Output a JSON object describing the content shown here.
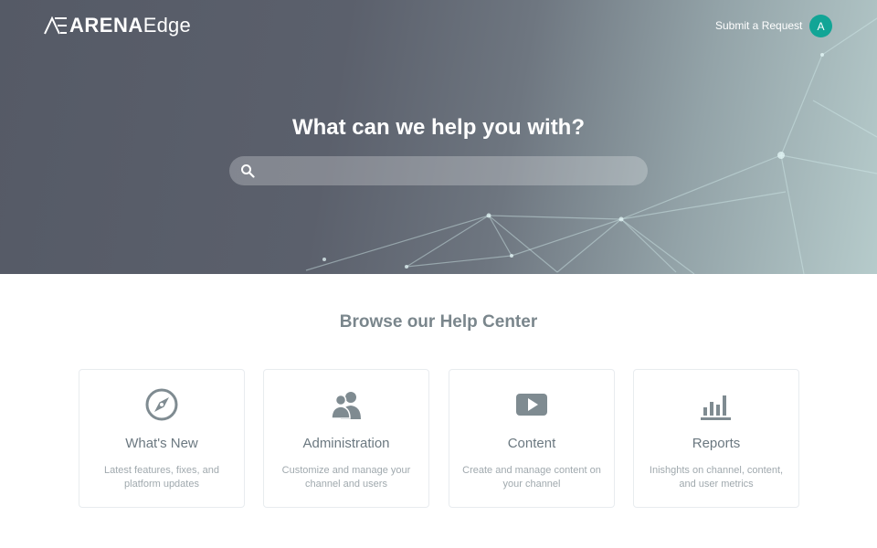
{
  "header": {
    "logo_bold": "ARENA",
    "logo_light": "Edge",
    "submit_request": "Submit a Request",
    "avatar_initial": "A"
  },
  "hero": {
    "title": "What can we help you with?",
    "search": {
      "value": "",
      "placeholder": ""
    }
  },
  "browse": {
    "title": "Browse our Help Center",
    "cards": [
      {
        "title": "What's New",
        "description": "Latest features, fixes, and platform updates",
        "icon": "compass-icon"
      },
      {
        "title": "Administration",
        "description": "Customize and manage your channel and users",
        "icon": "users-icon"
      },
      {
        "title": "Content",
        "description": "Create and manage content on your channel",
        "icon": "play-icon"
      },
      {
        "title": "Reports",
        "description": "Inishghts on channel, content, and user metrics",
        "icon": "bar-chart-icon"
      }
    ]
  },
  "colors": {
    "accent": "#12a596",
    "icon": "#7f8b91",
    "heading": "#7a868c"
  }
}
